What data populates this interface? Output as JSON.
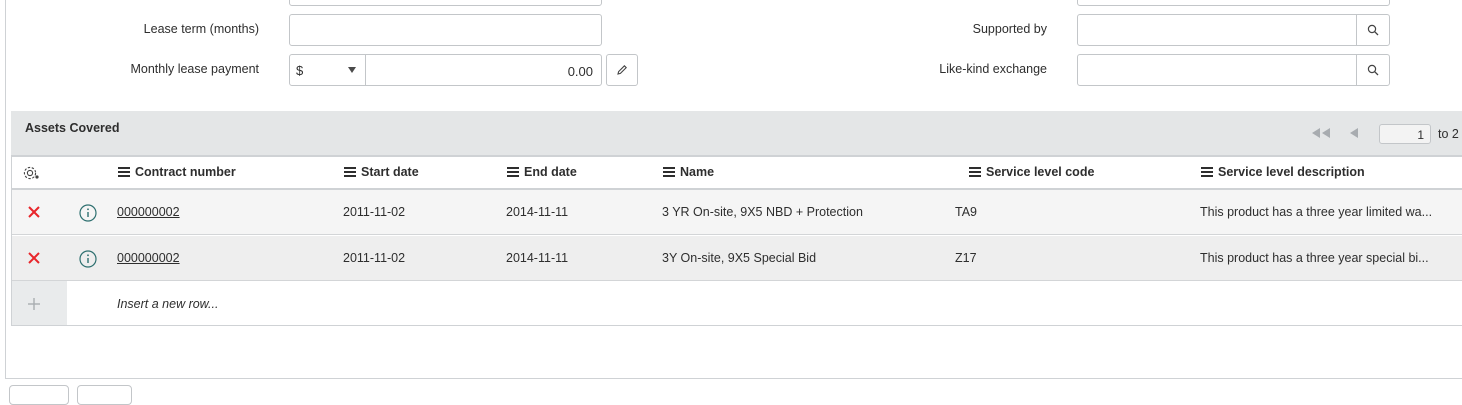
{
  "form": {
    "lease_term_label": "Lease term (months)",
    "lease_term_value": "",
    "monthly_payment_label": "Monthly lease payment",
    "currency": "$",
    "amount": "0.00",
    "supported_by_label": "Supported by",
    "supported_by_value": "",
    "like_kind_label": "Like-kind exchange",
    "like_kind_value": ""
  },
  "related_list": {
    "title": "Assets Covered",
    "pager": {
      "current": "1",
      "to_text": "to 2"
    },
    "columns": [
      "Contract number",
      "Start date",
      "End date",
      "Name",
      "Service level code",
      "Service level description"
    ],
    "rows": [
      {
        "contract_number": "000000002",
        "start_date": "2011-11-02",
        "end_date": "2014-11-11",
        "name": "3 YR On-site, 9X5 NBD + Protection",
        "service_level_code": "TA9",
        "service_level_description": "This product has a three year limited wa..."
      },
      {
        "contract_number": "000000002",
        "start_date": "2011-11-02",
        "end_date": "2014-11-11",
        "name": "3Y On-site, 9X5 Special Bid",
        "service_level_code": "Z17",
        "service_level_description": "This product has a three year special bi..."
      }
    ],
    "insert_row_text": "Insert a new row..."
  },
  "colors": {
    "delete": "#e8262b",
    "header_bg": "#e4e6e7",
    "border": "#c3c6c9"
  }
}
